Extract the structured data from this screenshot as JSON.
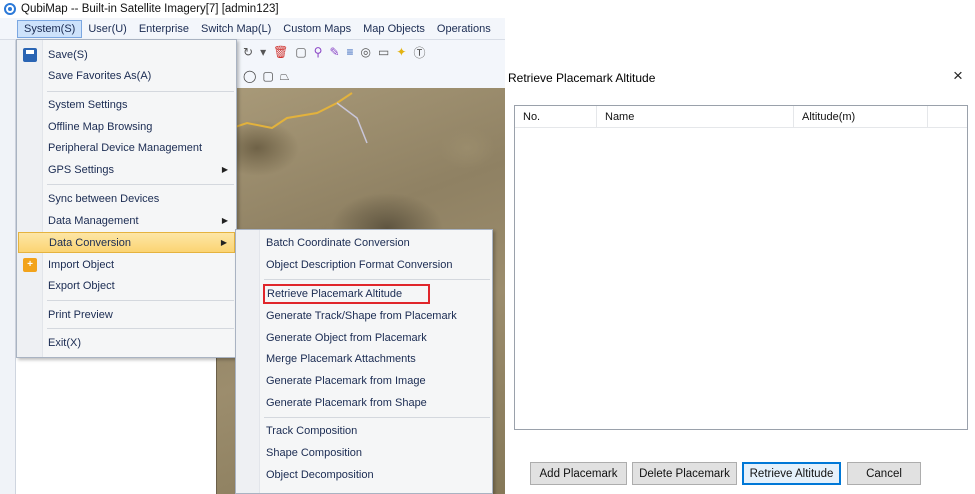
{
  "app": {
    "title": "QubiMap -- Built-in Satellite Imagery[7] [admin123]"
  },
  "menubar": {
    "items": [
      "System(S)",
      "User(U)",
      "Enterprise",
      "Switch Map(L)",
      "Custom Maps",
      "Map Objects",
      "Operations"
    ]
  },
  "system_menu": {
    "items": [
      {
        "label": "Save(S)",
        "icon": "save-icon"
      },
      {
        "label": "Save Favorites As(A)"
      },
      {
        "label": "System Settings"
      },
      {
        "label": "Offline Map Browsing"
      },
      {
        "label": "Peripheral Device Management"
      },
      {
        "label": "GPS Settings",
        "has_submenu": true
      },
      {
        "label": "Sync between Devices"
      },
      {
        "label": "Data Management",
        "has_submenu": true
      },
      {
        "label": "Data Conversion",
        "has_submenu": true,
        "highlighted": true
      },
      {
        "label": "Import Object",
        "icon": "import-icon"
      },
      {
        "label": "Export Object"
      },
      {
        "label": "Print Preview"
      },
      {
        "label": "Exit(X)"
      }
    ]
  },
  "data_conversion_submenu": {
    "items": [
      "Batch Coordinate Conversion",
      "Object Description Format Conversion",
      "Retrieve Placemark Altitude",
      "Generate Track/Shape from Placemark",
      "Generate Object from Placemark",
      "Merge Placemark Attachments",
      "Generate Placemark from Image",
      "Generate Placemark from Shape",
      "Track Composition",
      "Shape Composition",
      "Object Decomposition"
    ],
    "boxed_item": "Retrieve Placemark Altitude"
  },
  "dialog": {
    "title": "Retrieve Placemark Altitude",
    "close": "×",
    "columns": [
      "No.",
      "Name",
      "Altitude(m)"
    ],
    "buttons": {
      "add": "Add Placemark",
      "delete": "Delete Placemark",
      "retrieve": "Retrieve Altitude",
      "cancel": "Cancel"
    }
  },
  "colors": {
    "menu_text": "#1a2b52",
    "highlight_red": "#e0262b",
    "primary_button_border": "#0078d7"
  }
}
